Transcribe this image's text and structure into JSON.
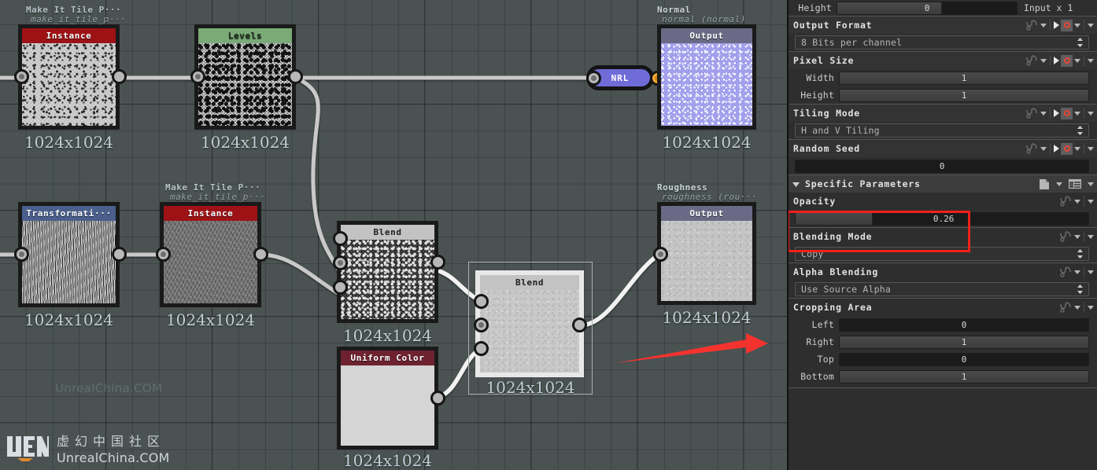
{
  "graph": {
    "nodes": [
      {
        "id": "n-instance-1",
        "title": "Instance",
        "header_color": "#9e1216",
        "label": "Make It Tile P···",
        "sublabel": "make_it_tile_p···",
        "caption": "1024x1024",
        "thumb": "noise-light"
      },
      {
        "id": "n-levels",
        "title": "Levels",
        "header_color": "#7aab77",
        "label": "",
        "sublabel": "",
        "caption": "1024x1024",
        "thumb": "noise-mid"
      },
      {
        "id": "n-output-normal",
        "title": "Output",
        "header_color": "#6a6a86",
        "label": "Normal",
        "sublabel": "normal (normal)",
        "caption": "1024x1024",
        "thumb": "normal-map"
      },
      {
        "id": "n-nrl",
        "title": "NRL",
        "header_color": "#6f6cd8",
        "label": "",
        "sublabel": "",
        "caption": "",
        "thumb": ""
      },
      {
        "id": "n-transformation",
        "title": "Transformati···",
        "header_color": "#4a5f8c",
        "label": "",
        "sublabel": "",
        "caption": "1024x1024",
        "thumb": "fiber"
      },
      {
        "id": "n-instance-2",
        "title": "Instance",
        "header_color": "#9e1216",
        "label": "Make It Tile P···",
        "sublabel": "make_it_tile_p···",
        "caption": "1024x1024",
        "thumb": "fiber-dark"
      },
      {
        "id": "n-blend-1",
        "title": "Blend",
        "header_color": "#c3c3c3",
        "label": "",
        "sublabel": "",
        "caption": "1024x1024",
        "thumb": "noise-dark"
      },
      {
        "id": "n-uniform-color",
        "title": "Uniform Color",
        "header_color": "#6e2230",
        "label": "",
        "sublabel": "",
        "caption": "1024x1024",
        "thumb": "flat-light"
      },
      {
        "id": "n-blend-2",
        "title": "Blend",
        "header_color": "#c3c3c3",
        "label": "",
        "sublabel": "",
        "caption": "1024x1024",
        "thumb": "noise-pale"
      },
      {
        "id": "n-output-roughness",
        "title": "Output",
        "header_color": "#6a6a86",
        "label": "Roughness",
        "sublabel": "roughness (rou···",
        "caption": "1024x1024",
        "thumb": "noise-pale"
      }
    ],
    "watermark_faint": "UnrealChina.COM",
    "brand_cn": "虚幻中国社区",
    "brand_en": "UnrealChina.COM",
    "brand_logo": "VECN"
  },
  "panel": {
    "input_note": "Input x 1",
    "rows": [
      {
        "type": "slider",
        "name": "height-top",
        "label": "Height",
        "value": "0",
        "fill_pct": 58,
        "dark": true
      },
      {
        "type": "group",
        "name": "output-format",
        "label": "Output Format"
      },
      {
        "type": "combo",
        "name": "output-format-combo",
        "value": "8 Bits per channel"
      },
      {
        "type": "group",
        "name": "pixel-size",
        "label": "Pixel Size"
      },
      {
        "type": "slider",
        "name": "pixel-width",
        "label": "Width",
        "value": "1",
        "fill_pct": 100,
        "dark": false
      },
      {
        "type": "slider",
        "name": "pixel-height",
        "label": "Height",
        "value": "1",
        "fill_pct": 100,
        "dark": false
      },
      {
        "type": "group",
        "name": "tiling-mode",
        "label": "Tiling Mode"
      },
      {
        "type": "combo",
        "name": "tiling-mode-combo",
        "value": "H and V Tiling"
      },
      {
        "type": "group",
        "name": "random-seed",
        "label": "Random Seed"
      },
      {
        "type": "slider",
        "name": "random-seed-value",
        "label": "",
        "value": "0",
        "fill_pct": 0,
        "dark": true
      },
      {
        "type": "section",
        "name": "specific-parameters",
        "label": "Specific Parameters"
      },
      {
        "type": "group",
        "name": "opacity",
        "label": "Opacity"
      },
      {
        "type": "slider",
        "name": "opacity-value",
        "label": "",
        "value": "0.26",
        "fill_pct": 26,
        "dark": true
      },
      {
        "type": "group",
        "name": "blending-mode",
        "label": "Blending Mode"
      },
      {
        "type": "combo",
        "name": "blending-mode-combo",
        "value": "Copy"
      },
      {
        "type": "group",
        "name": "alpha-blending",
        "label": "Alpha Blending"
      },
      {
        "type": "combo",
        "name": "alpha-blending-combo",
        "value": "Use Source Alpha"
      },
      {
        "type": "group",
        "name": "cropping-area",
        "label": "Cropping Area"
      },
      {
        "type": "slider",
        "name": "crop-left",
        "label": "Left",
        "value": "0",
        "fill_pct": 0,
        "dark": true
      },
      {
        "type": "slider",
        "name": "crop-right",
        "label": "Right",
        "value": "1",
        "fill_pct": 100,
        "dark": false
      },
      {
        "type": "slider",
        "name": "crop-top",
        "label": "Top",
        "value": "0",
        "fill_pct": 0,
        "dark": true
      },
      {
        "type": "slider",
        "name": "crop-bottom",
        "label": "Bottom",
        "value": "1",
        "fill_pct": 100,
        "dark": false
      }
    ]
  },
  "annotations": {
    "highlight_color": "#f0201c",
    "arrow_color": "#f5332e"
  }
}
